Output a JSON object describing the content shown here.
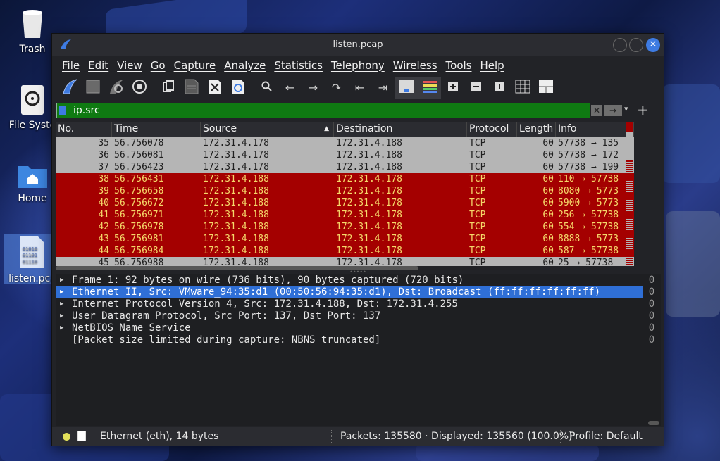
{
  "desktop": {
    "icons": [
      {
        "label": "Trash"
      },
      {
        "label": "File Syste"
      },
      {
        "label": "Home"
      },
      {
        "label": "listen.pca"
      }
    ],
    "file_glyph": "01010\n01101\n01110"
  },
  "window": {
    "title": "listen.pcap",
    "close_glyph": "✕"
  },
  "menu": [
    "File",
    "Edit",
    "View",
    "Go",
    "Capture",
    "Analyze",
    "Statistics",
    "Telephony",
    "Wireless",
    "Tools",
    "Help"
  ],
  "filter": {
    "value": "ip.src",
    "clear_glyph": "✕",
    "apply_glyph": "→",
    "dropdown_glyph": "▾",
    "add_glyph": "+"
  },
  "columns": [
    "No.",
    "Time",
    "Source",
    "Destination",
    "Protocol",
    "Length",
    "Info"
  ],
  "packets": [
    {
      "no": "35",
      "time": "56.756078",
      "src": "172.31.4.178",
      "dst": "172.31.4.188",
      "proto": "TCP",
      "len": "60",
      "info": "57738 → 135",
      "style": "gray"
    },
    {
      "no": "36",
      "time": "56.756081",
      "src": "172.31.4.178",
      "dst": "172.31.4.188",
      "proto": "TCP",
      "len": "60",
      "info": "57738 → 172",
      "style": "gray"
    },
    {
      "no": "37",
      "time": "56.756423",
      "src": "172.31.4.178",
      "dst": "172.31.4.188",
      "proto": "TCP",
      "len": "60",
      "info": "57738 → 199",
      "style": "gray"
    },
    {
      "no": "38",
      "time": "56.756431",
      "src": "172.31.4.188",
      "dst": "172.31.4.178",
      "proto": "TCP",
      "len": "60",
      "info": "110 → 57738",
      "style": "red"
    },
    {
      "no": "39",
      "time": "56.756658",
      "src": "172.31.4.188",
      "dst": "172.31.4.178",
      "proto": "TCP",
      "len": "60",
      "info": "8080 → 5773",
      "style": "red"
    },
    {
      "no": "40",
      "time": "56.756672",
      "src": "172.31.4.188",
      "dst": "172.31.4.178",
      "proto": "TCP",
      "len": "60",
      "info": "5900 → 5773",
      "style": "red"
    },
    {
      "no": "41",
      "time": "56.756971",
      "src": "172.31.4.188",
      "dst": "172.31.4.178",
      "proto": "TCP",
      "len": "60",
      "info": "256 → 57738",
      "style": "red"
    },
    {
      "no": "42",
      "time": "56.756978",
      "src": "172.31.4.188",
      "dst": "172.31.4.178",
      "proto": "TCP",
      "len": "60",
      "info": "554 → 57738",
      "style": "red"
    },
    {
      "no": "43",
      "time": "56.756981",
      "src": "172.31.4.188",
      "dst": "172.31.4.178",
      "proto": "TCP",
      "len": "60",
      "info": "8888 → 5773",
      "style": "red"
    },
    {
      "no": "44",
      "time": "56.756984",
      "src": "172.31.4.188",
      "dst": "172.31.4.178",
      "proto": "TCP",
      "len": "60",
      "info": "587 → 57738",
      "style": "red"
    },
    {
      "no": "45",
      "time": "56.756988",
      "src": "172.31.4.188",
      "dst": "172.31.4.178",
      "proto": "TCP",
      "len": "60",
      "info": "25 → 57738",
      "style": "gray"
    }
  ],
  "details": [
    {
      "text": "Frame 1: 92 bytes on wire (736 bits), 90 bytes captured (720 bits)",
      "expandable": true,
      "selected": false
    },
    {
      "text": "Ethernet II, Src: VMware_94:35:d1 (00:50:56:94:35:d1), Dst: Broadcast (ff:ff:ff:ff:ff:ff)",
      "expandable": true,
      "selected": true
    },
    {
      "text": "Internet Protocol Version 4, Src: 172.31.4.188, Dst: 172.31.4.255",
      "expandable": true,
      "selected": false
    },
    {
      "text": "User Datagram Protocol, Src Port: 137, Dst Port: 137",
      "expandable": true,
      "selected": false
    },
    {
      "text": "NetBIOS Name Service",
      "expandable": true,
      "selected": false
    },
    {
      "text": "[Packet size limited during capture: NBNS truncated]",
      "expandable": false,
      "selected": false
    }
  ],
  "bytes": [
    "0",
    "0",
    "0",
    "0",
    "0",
    "0"
  ],
  "status": {
    "field": "Ethernet (eth), 14 bytes",
    "packets": "Packets: 135580 · Displayed: 135560 (100.0%)",
    "profile": "Profile: Default"
  },
  "colors": {
    "row_red_bg": "#a40000",
    "row_red_fg": "#f5d86a",
    "row_gray_bg": "#b5b5b5",
    "filter_bg": "#0f7a12",
    "selection": "#2f6fd6",
    "accent": "#3e7be2"
  },
  "toolbar_icons": [
    "shark-fin-icon",
    "stop-icon",
    "restart-icon",
    "options-gear-icon",
    "open-file-icon",
    "save-file-icon",
    "close-file-icon",
    "reload-icon",
    "search-icon",
    "back-arrow-icon",
    "forward-arrow-icon",
    "go-to-packet-icon",
    "first-packet-icon",
    "last-packet-icon",
    "autoscroll-icon",
    "colorize-icon",
    "zoom-in-icon",
    "zoom-out-icon",
    "normal-size-icon",
    "resize-columns-icon",
    "layout-icon"
  ]
}
